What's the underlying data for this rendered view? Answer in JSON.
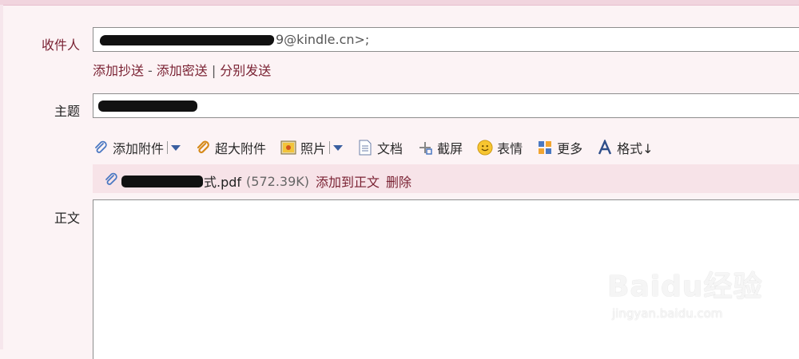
{
  "recipient": {
    "label": "收件人",
    "email_suffix": "9@kindle.cn>;"
  },
  "cc_links": {
    "add_cc": "添加抄送",
    "dash": "-",
    "add_bcc": "添加密送",
    "pipe": "|",
    "send_separately": "分别发送"
  },
  "subject": {
    "label": "主题"
  },
  "toolbar": {
    "add_attachment": "添加附件",
    "large_attachment": "超大附件",
    "photo": "照片",
    "document": "文档",
    "screenshot": "截屏",
    "emoji": "表情",
    "more": "更多",
    "format": "格式↓"
  },
  "attachment": {
    "name_suffix": "式.pdf",
    "size": "(572.39K)",
    "add_to_body": "添加到正文",
    "delete": "删除"
  },
  "body": {
    "label": "正文"
  },
  "watermark": {
    "logo": "Baidu经验",
    "url": "jingyan.baidu.com"
  },
  "colors": {
    "link": "#7a2233",
    "background": "#fcf3f5",
    "attachment_bar": "#f7e3e8"
  }
}
